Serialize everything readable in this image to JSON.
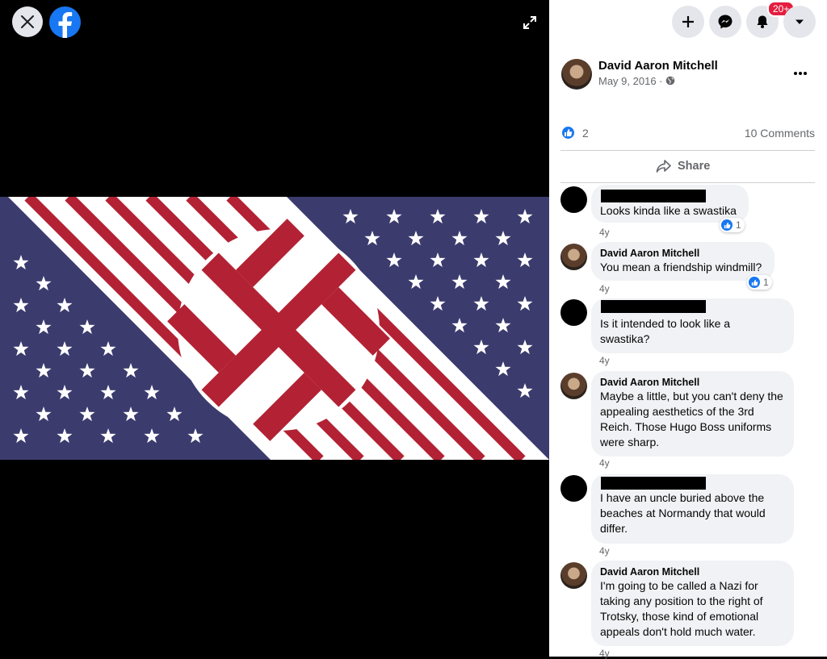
{
  "viewer": {
    "close_icon": "close-icon",
    "logo_icon": "facebook-logo-icon",
    "expand_icon": "expand-icon"
  },
  "topbar": {
    "create_icon": "plus-icon",
    "messenger_icon": "messenger-icon",
    "notifications_icon": "bell-icon",
    "notification_badge": "20+",
    "account_icon": "caret-down-icon"
  },
  "post": {
    "author": "David Aaron Mitchell",
    "date": "May 9, 2016 ·",
    "privacy_icon": "globe-icon",
    "more_icon": "more-dots-icon",
    "like_count": "2",
    "comments_count": "10 Comments",
    "share_label": "Share"
  },
  "comments": [
    {
      "name": "",
      "redacted": true,
      "text": "Looks kinda like a swastika",
      "age": "4y",
      "reactions": "1"
    },
    {
      "name": "David Aaron Mitchell",
      "redacted": false,
      "text": "You mean a friendship windmill?",
      "age": "4y",
      "reactions": "1"
    },
    {
      "name": "",
      "redacted": true,
      "text": "Is it intended to look like a swastika?",
      "age": "4y"
    },
    {
      "name": "David Aaron Mitchell",
      "redacted": false,
      "text": "Maybe a little, but you can't deny the appealing aesthetics of the 3rd Reich. Those Hugo Boss uniforms were sharp.",
      "age": "4y"
    },
    {
      "name": "",
      "redacted": true,
      "text": "I have an uncle buried above the beaches at Normandy that would differ.",
      "age": "4y"
    },
    {
      "name": "David Aaron Mitchell",
      "redacted": false,
      "text": "I'm going to be called a Nazi for taking any position to the right of Trotsky, those kind of emotional appeals don't hold much water.",
      "age": "4y"
    }
  ],
  "colors": {
    "navy": "#3c3b6e",
    "flag_red": "#b22234",
    "facebook_blue": "#1877f2",
    "badge_red": "#e41e3f"
  }
}
